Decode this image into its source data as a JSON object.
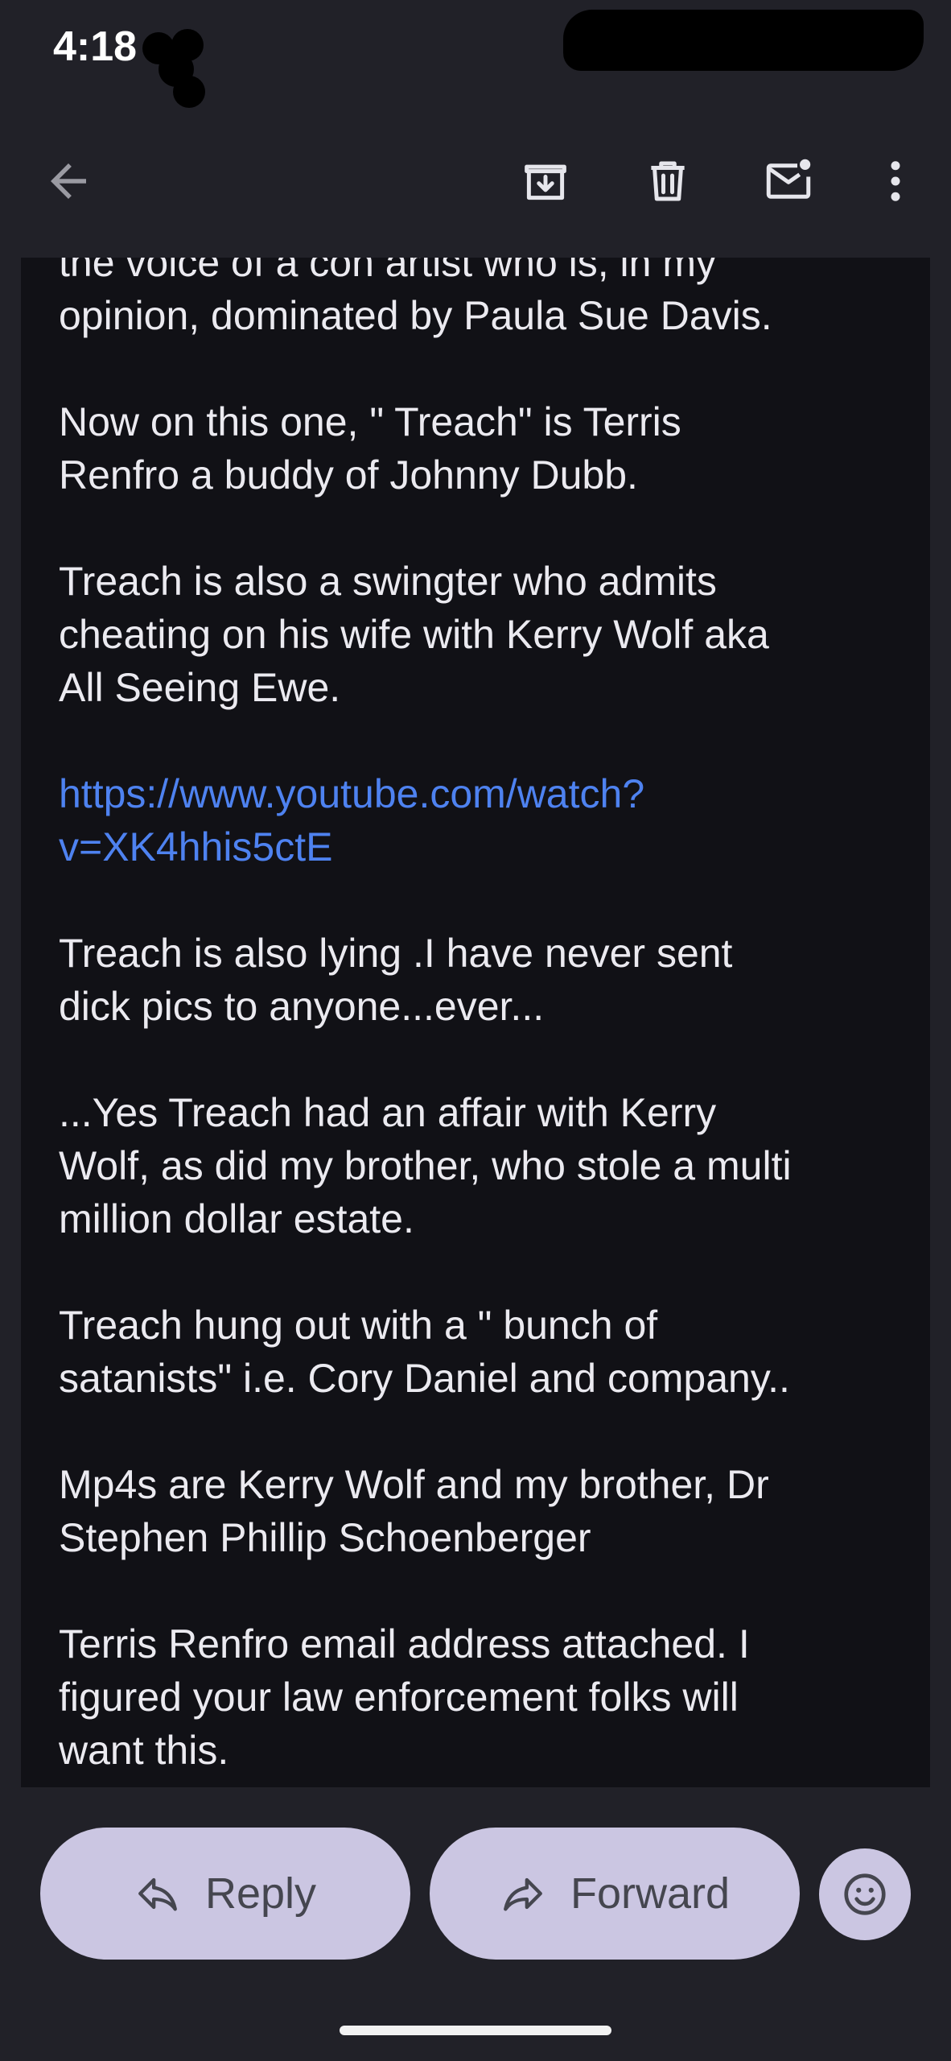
{
  "status_bar": {
    "time": "4:18"
  },
  "toolbar": {
    "back": "back-arrow-icon",
    "archive": "archive-icon",
    "delete": "trash-icon",
    "mark_unread": "mark-unread-icon",
    "more": "more-vert-icon"
  },
  "message": {
    "paragraphs": [
      {
        "text": "the voice of a con artist who is, in my\nopinion, dominated by Paula Sue Davis.",
        "link": false
      },
      {
        "text": "Now on this one, \" Treach\" is Terris\nRenfro a buddy of Johnny Dubb.",
        "link": false
      },
      {
        "text": "Treach is also a swingter who admits\ncheating on his wife with Kerry Wolf aka\nAll Seeing Ewe.",
        "link": false
      },
      {
        "text": "https://www.youtube.com/watch?\nv=XK4hhis5ctE",
        "link": true
      },
      {
        "text": "Treach is also lying .I have never sent\ndick pics to anyone...ever...",
        "link": false
      },
      {
        "text": "...Yes Treach had an affair with Kerry\nWolf, as did my brother, who stole a multi\nmillion dollar estate.",
        "link": false
      },
      {
        "text": "Treach hung out with a \" bunch of\nsatanists\" i.e. Cory Daniel and company..",
        "link": false
      },
      {
        "text": "Mp4s are Kerry Wolf and my brother, Dr\nStephen Phillip Schoenberger",
        "link": false
      },
      {
        "text": "Terris Renfro email address attached. I\nfigured your law enforcement folks will\nwant this.",
        "link": false
      }
    ]
  },
  "actions": {
    "reply_label": "Reply",
    "forward_label": "Forward",
    "emoji": "emoji-smile-icon"
  },
  "colors": {
    "background": "#212128",
    "content_background": "#111116",
    "text": "#ebeaf0",
    "link": "#4e82f0",
    "button": "#cbc6e2",
    "button_text": "#45464f"
  }
}
